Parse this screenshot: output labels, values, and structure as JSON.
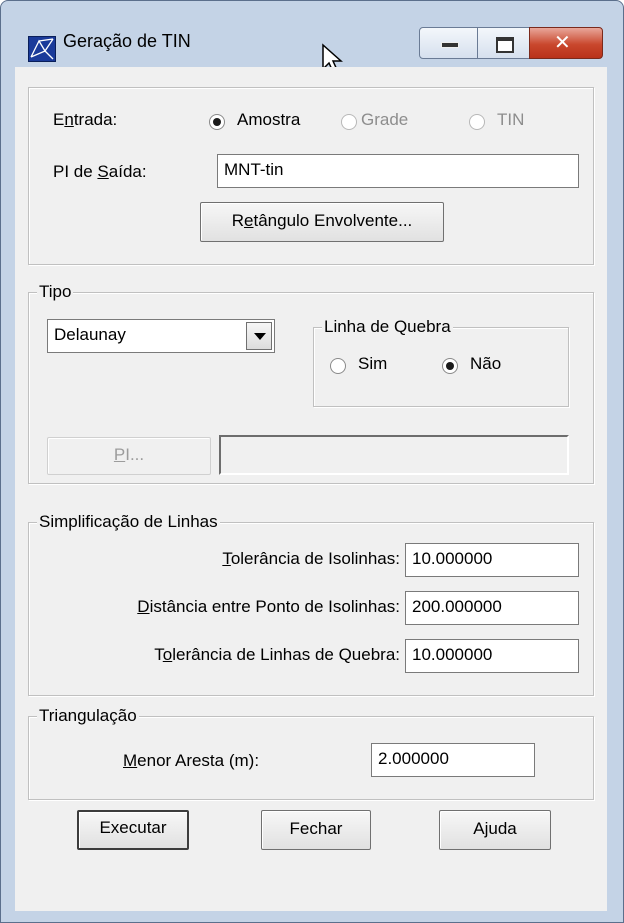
{
  "window": {
    "title": "Geração de TIN",
    "colors": {
      "frame": "#c4d3e6",
      "close": "#c9472d",
      "client": "#f0f0f0"
    },
    "controls": [
      "minimize-icon",
      "maximize-icon",
      "close-icon"
    ]
  },
  "entrada": {
    "label_pre": "E",
    "label_u": "n",
    "label_post": "trada:",
    "options": [
      {
        "label": "Amostra",
        "selected": true,
        "enabled": true
      },
      {
        "label": "Grade",
        "selected": false,
        "enabled": false
      },
      {
        "label": "TIN",
        "selected": false,
        "enabled": false
      }
    ],
    "saida_pre": "PI de ",
    "saida_u": "S",
    "saida_post": "aída:",
    "saida_value": "MNT-tin",
    "retangulo_pre": "R",
    "retangulo_u": "e",
    "retangulo_post": "tângulo Envolvente..."
  },
  "tipo": {
    "legend": "Tipo",
    "select_value": "Delaunay",
    "linha_quebra": {
      "legend": "Linha de Quebra",
      "options": [
        {
          "label": "Sim",
          "selected": false
        },
        {
          "label": "Não",
          "selected": true
        }
      ]
    },
    "pi_button_u": "P",
    "pi_button_post": "I...",
    "pi_value": ""
  },
  "simplificacao": {
    "legend": "Simplificação de Linhas",
    "fields": [
      {
        "pre": "",
        "u": "T",
        "post": "olerância de Isolinhas:",
        "value": "10.000000"
      },
      {
        "pre": "",
        "u": "D",
        "post": "istância entre Ponto de Isolinhas:",
        "value": "200.000000"
      },
      {
        "pre": "T",
        "u": "o",
        "post": "lerância de Linhas de Quebra:",
        "value": "10.000000"
      }
    ]
  },
  "triangulacao": {
    "legend": "Triangulação",
    "menor_u": "M",
    "menor_post": "enor Aresta (m):",
    "menor_value": "2.000000"
  },
  "buttons": {
    "executar": "Executar",
    "fechar": "Fechar",
    "ajuda": "Ajuda"
  }
}
